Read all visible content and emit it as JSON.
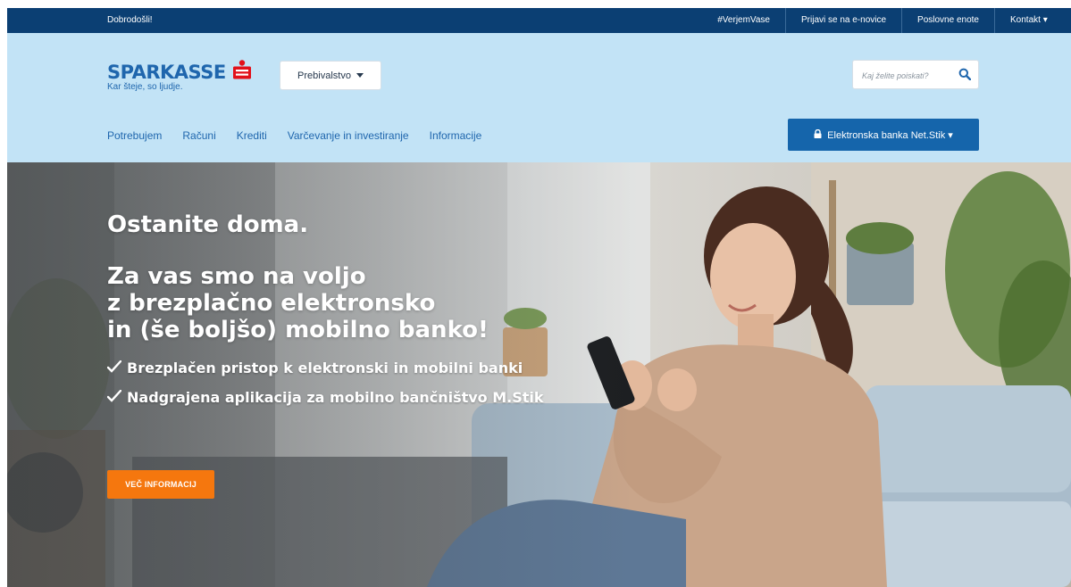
{
  "topbar": {
    "welcome": "Dobrodošli!",
    "links": [
      {
        "label": "#VerjemVase"
      },
      {
        "label": "Prijavi se na e-novice"
      },
      {
        "label": "Poslovne enote"
      },
      {
        "label": "Kontakt ▾"
      }
    ]
  },
  "header": {
    "logo_text": "SPARKASSE",
    "logo_slogan": "Kar šteje, so ljudje.",
    "residence_dropdown": "Prebivalstvo",
    "search_placeholder": "Kaj želite poiskati?",
    "nav": [
      {
        "label": "Potrebujem"
      },
      {
        "label": "Računi"
      },
      {
        "label": "Krediti"
      },
      {
        "label": "Varčevanje in investiranje"
      },
      {
        "label": "Informacije"
      }
    ],
    "ebank_button": "Elektronska banka Net.Stik ▾"
  },
  "hero": {
    "title": "Ostanite doma.",
    "subtitle_lines": [
      "Za vas smo na voljo",
      "z brezplačno elektronsko",
      "in (še boljšo) mobilno banko!"
    ],
    "bullets": [
      "Brezplačen pristop k elektronski in mobilni banki",
      "Nadgrajena aplikacija za mobilno bančništvo M.Stik"
    ],
    "cta": "VEČ INFORMACIJ"
  },
  "colors": {
    "topbar": "#0b3f73",
    "header_bg": "#c2e3f6",
    "brand_blue": "#1f66ad",
    "button_blue": "#1565ab",
    "logo_red": "#e2111a",
    "cta_orange": "#f5770e"
  },
  "icons": {
    "search": "search-icon",
    "lock": "lock-icon",
    "caret": "caret-down-icon",
    "check": "check-icon",
    "logo_mark": "sparkasse-s-logo-icon"
  }
}
